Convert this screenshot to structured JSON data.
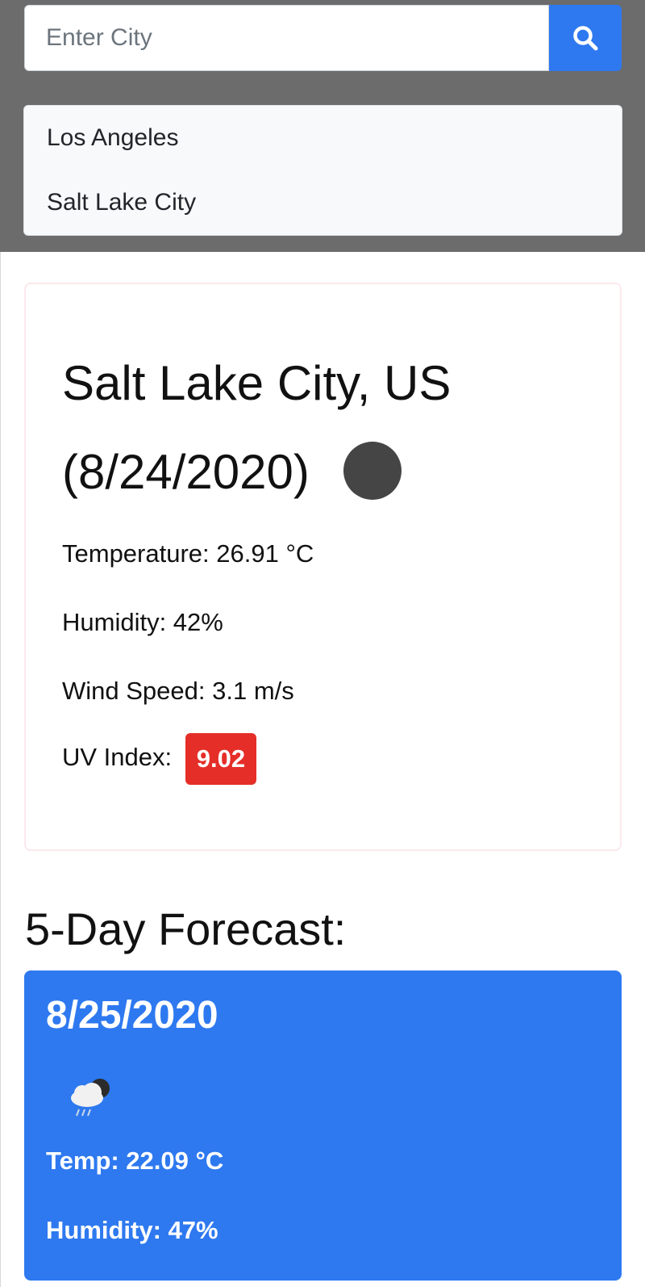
{
  "search": {
    "placeholder": "Enter City",
    "value": "",
    "button_icon": "search-icon"
  },
  "history": [
    {
      "label": "Los Angeles"
    },
    {
      "label": "Salt Lake City"
    }
  ],
  "current": {
    "city": "Salt Lake City, US",
    "date": "(8/24/2020)",
    "weather_icon": "dark-circle-icon",
    "temperature": "Temperature: 26.91 °C",
    "humidity": "Humidity: 42%",
    "wind": "Wind Speed: 3.1 m/s",
    "uv_label": "UV Index:",
    "uv_value": "9.02",
    "uv_color": "#e52e28"
  },
  "forecast": {
    "heading": "5-Day Forecast:",
    "days": [
      {
        "date": "8/25/2020",
        "icon": "rain-cloud-icon",
        "temp": "Temp: 22.09 °C",
        "humidity": "Humidity: 47%"
      }
    ]
  },
  "colors": {
    "panel_bg": "#6c6c6c",
    "primary": "#2e79f0",
    "uv_high": "#e52e28"
  }
}
